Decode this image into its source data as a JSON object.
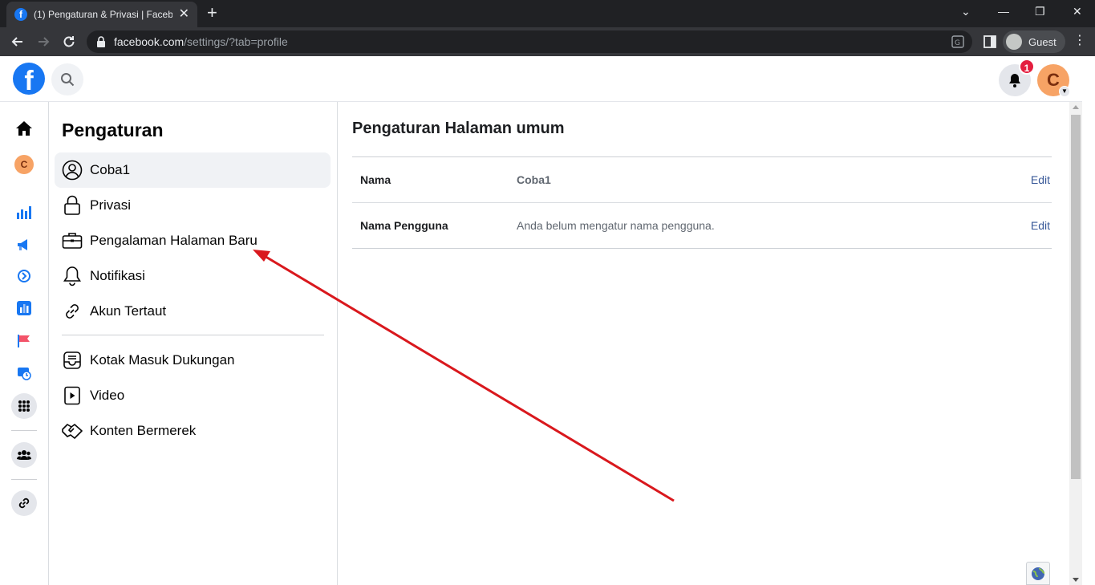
{
  "browser": {
    "tab_title": "(1) Pengaturan & Privasi | Facebook",
    "tab_favicon": "f",
    "url_host": "facebook.com",
    "url_path": "/settings/?tab=profile",
    "profile_label": "Guest"
  },
  "fb_header": {
    "logo": "f",
    "notification_count": "1",
    "avatar_letter": "C"
  },
  "rail": {
    "avatar_letter": "C",
    "icons": [
      "home-icon",
      "profile-avatar",
      "insights-icon",
      "ads-icon",
      "creator-icon",
      "stats-icon",
      "flag-icon",
      "scheduler-icon",
      "apps-grid-icon",
      "people-icon",
      "link-icon"
    ]
  },
  "settings_nav": {
    "title": "Pengaturan",
    "items": [
      {
        "label": "Coba1",
        "icon": "profile-circle-icon",
        "active": true
      },
      {
        "label": "Privasi",
        "icon": "lock-icon"
      },
      {
        "label": "Pengalaman Halaman Baru",
        "icon": "briefcase-icon"
      },
      {
        "label": "Notifikasi",
        "icon": "bell-icon"
      },
      {
        "label": "Akun Tertaut",
        "icon": "link-icon"
      },
      {
        "label": "Kotak Masuk Dukungan",
        "icon": "inbox-icon"
      },
      {
        "label": "Video",
        "icon": "video-icon"
      },
      {
        "label": "Konten Bermerek",
        "icon": "handshake-icon"
      }
    ]
  },
  "main": {
    "title": "Pengaturan Halaman umum",
    "rows": [
      {
        "label": "Nama",
        "value": "Coba1",
        "edit": "Edit"
      },
      {
        "label": "Nama Pengguna",
        "value": "Anda belum mengatur nama pengguna.",
        "edit": "Edit"
      }
    ]
  },
  "colors": {
    "brand_blue": "#1877f2",
    "annotation_red": "#d9181d",
    "link_blue": "#385898",
    "avatar_orange": "#f7a365"
  }
}
